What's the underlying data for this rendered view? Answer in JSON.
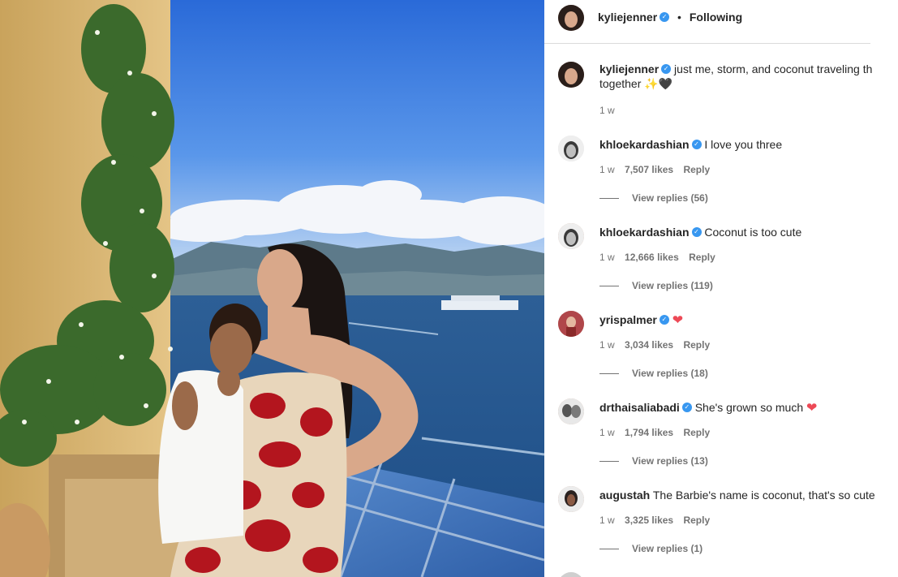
{
  "post": {
    "author": "kyliejenner",
    "follow_status": "Following",
    "separator": "•",
    "caption_line1": "just me, storm, and coconut traveling th",
    "caption_line2": "together",
    "caption_emoji": "✨🖤",
    "caption_age": "1 w"
  },
  "comments": [
    {
      "user": "khloekardashian",
      "verified": true,
      "text": "I love you three",
      "heart": false,
      "age": "1 w",
      "likes": "7,507 likes",
      "reply": "Reply",
      "view_replies": "View replies (56)"
    },
    {
      "user": "khloekardashian",
      "verified": true,
      "text": "Coconut is too cute",
      "heart": false,
      "age": "1 w",
      "likes": "12,666 likes",
      "reply": "Reply",
      "view_replies": "View replies (119)"
    },
    {
      "user": "yrispalmer",
      "verified": true,
      "text": "",
      "heart": true,
      "age": "1 w",
      "likes": "3,034 likes",
      "reply": "Reply",
      "view_replies": "View replies (18)"
    },
    {
      "user": "drthaisaliabadi",
      "verified": true,
      "text": "She's grown so much",
      "heart": true,
      "age": "1 w",
      "likes": "1,794 likes",
      "reply": "Reply",
      "view_replies": "View replies (13)"
    },
    {
      "user": "augustah",
      "verified": false,
      "text": "The Barbie's name is coconut, that's so cute",
      "heart": false,
      "age": "1 w",
      "likes": "3,325 likes",
      "reply": "Reply",
      "view_replies": "View replies (1)"
    }
  ],
  "icons": {
    "verified": "verified-badge-icon",
    "heart": "red-heart-icon"
  },
  "colors": {
    "verified_blue": "#3897f0",
    "muted_text": "#737373",
    "heart_red": "#ed4956"
  }
}
